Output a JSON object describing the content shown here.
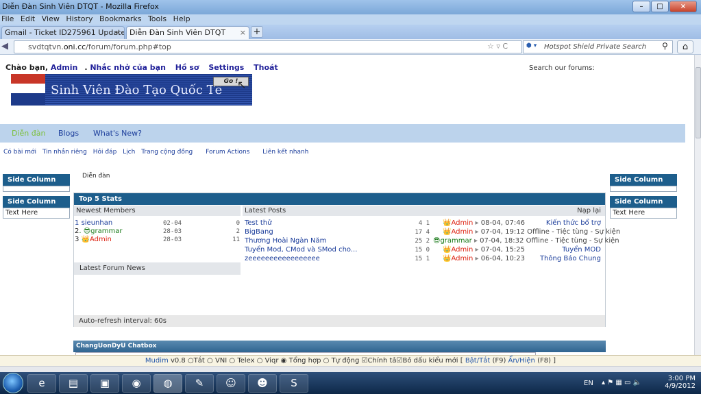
{
  "window": {
    "title": "Diễn Đàn Sinh Viên DTQT - Mozilla Firefox",
    "menu": [
      "File",
      "Edit",
      "View",
      "History",
      "Bookmarks",
      "Tools",
      "Help"
    ]
  },
  "tabs": [
    {
      "label": "Gmail - Ticket ID275961 Updated at A...",
      "close": "×"
    },
    {
      "label": "Diễn Đàn Sinh Viên DTQT",
      "close": "×"
    }
  ],
  "newtab": "+",
  "url": {
    "prefix": "svdtqtvn.",
    "domain": "oni.cc",
    "path": "/forum/forum.php#top"
  },
  "search_placeholder": "Hotspot Shield Private Search",
  "forum": {
    "greeting": "Chào bạn,",
    "user": "Admin",
    "links": [
      "Nhắc nhở của bạn",
      "Hồ sơ",
      "Settings",
      "Thoát"
    ],
    "search_label": "Search our forums:",
    "logo_text": "Sinh Viên Đào Tạo Quốc Tế",
    "go_button": "Go !",
    "nav": [
      "Diễn đàn",
      "Blogs",
      "What's New?"
    ],
    "sublinks": [
      "Có bài mới",
      "Tin nhắn riêng",
      "Hỏi đáp",
      "Lịch",
      "Trang cộng đồng",
      "Forum Actions",
      "Liên kết nhanh"
    ],
    "breadcrumb": "Diễn đàn"
  },
  "sidebar_left": [
    {
      "title": "Side Column",
      "body": ""
    },
    {
      "title": "Side Column",
      "body": "Text Here"
    }
  ],
  "sidebar_right": [
    {
      "title": "Side Column",
      "body": ""
    },
    {
      "title": "Side Column",
      "body": "Text Here"
    }
  ],
  "stats": {
    "title": "Top 5 Stats",
    "col_members": "Newest Members",
    "col_posts": "Latest Posts",
    "col_reload": "Nạp lại",
    "members": [
      {
        "rank": "1",
        "name": "sieunhan",
        "date": "02-04",
        "count": "0"
      },
      {
        "rank": "2",
        "name": "grammar",
        "date": "28-03",
        "count": "2"
      },
      {
        "rank": "3",
        "name": "Admin",
        "date": "28-03",
        "count": "11"
      }
    ],
    "posts": [
      {
        "title": "Test thử",
        "counts": "4 1",
        "user": "Admin",
        "when": "08-04, 07:46",
        "forum": "Kiến thức bổ trợ"
      },
      {
        "title": "BigBang",
        "counts": "17 4",
        "user": "Admin",
        "when": "07-04, 19:12 Offline - Tiệc tùng - Sự kiện",
        "forum": ""
      },
      {
        "title": "Thương Hoài Ngàn Năm",
        "counts": "25 2",
        "user": "grammar",
        "when": "07-04, 18:32 Offline - Tiệc tùng - Sự kiện",
        "forum": ""
      },
      {
        "title": "Tuyển Mod, CMod và SMod cho...",
        "counts": "15 0",
        "user": "Admin",
        "when": "07-04, 15:25",
        "forum": "Tuyển MOD"
      },
      {
        "title": "zeeeeeeeeeeeeeeeee",
        "counts": "15 1",
        "user": "Admin",
        "when": "06-04, 10:23",
        "forum": "Thông Báo Chung"
      }
    ],
    "news_title": "Latest Forum News",
    "refresh": "Auto-refresh interval: 60s"
  },
  "chatbox": "ChangUonDyU Chatbox",
  "mudim": {
    "brand": "Mudim",
    "version": "v0.8",
    "options": [
      "Tắt",
      "VNI",
      "Telex",
      "Viqr",
      "Tổng hợp",
      "Tự động"
    ],
    "check1": "Chính tả",
    "check2": "Bỏ dấu kiểu mới",
    "toggle": "Bật/Tắt",
    "toggle_key": "(F9)",
    "show": "Ẩn/Hiện",
    "show_key": "(F8)"
  },
  "taskbar": {
    "lang": "EN",
    "time": "3:00 PM",
    "date": "4/9/2012"
  }
}
